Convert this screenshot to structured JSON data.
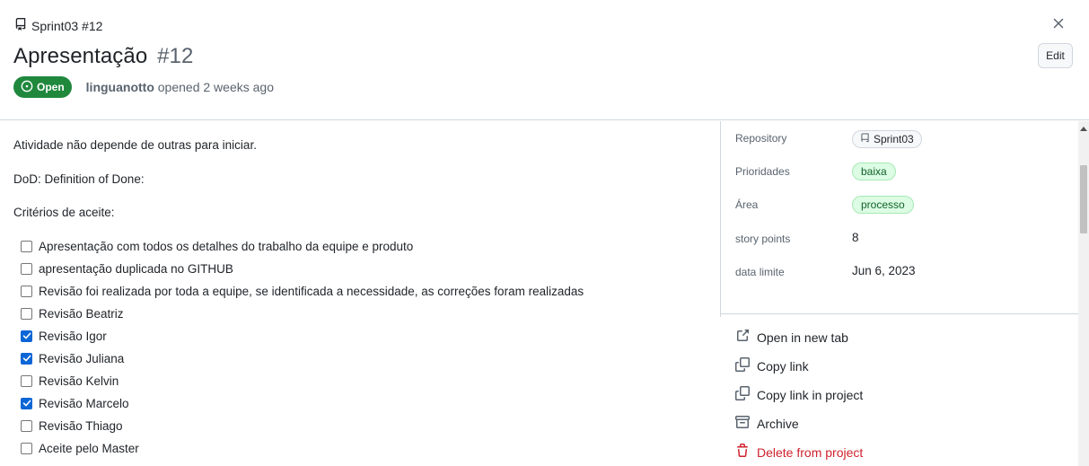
{
  "header": {
    "breadcrumb": "Sprint03 #12",
    "title": "Apresentação",
    "number": "#12",
    "state": "Open",
    "author": "linguanotto",
    "opened_text": "opened 2 weeks ago",
    "edit_label": "Edit",
    "close_icon": "close-icon"
  },
  "body": {
    "paragraphs": [
      "Atividade não depende de outras para iniciar.",
      "DoD: Definition of Done:",
      "Critérios de aceite:"
    ],
    "tasks": [
      {
        "label": "Apresentação com todos os detalhes do trabalho da equipe e produto",
        "checked": false
      },
      {
        "label": "apresentação duplicada no GITHUB",
        "checked": false
      },
      {
        "label": "Revisão foi realizada por toda a equipe, se identificada a necessidade, as correções foram realizadas",
        "checked": false
      },
      {
        "label": "Revisão Beatriz",
        "checked": false
      },
      {
        "label": "Revisão Igor",
        "checked": true
      },
      {
        "label": "Revisão Juliana",
        "checked": true
      },
      {
        "label": "Revisão Kelvin",
        "checked": false
      },
      {
        "label": "Revisão Marcelo",
        "checked": true
      },
      {
        "label": "Revisão Thiago",
        "checked": false
      },
      {
        "label": "Aceite pelo Master",
        "checked": false
      }
    ]
  },
  "fields": {
    "repository_label": "Repository",
    "repository_value": "Sprint03",
    "prioridades_label": "Prioridades",
    "prioridades_value": "baixa",
    "area_label": "Área",
    "area_value": "processo",
    "story_points_label": "story points",
    "story_points_value": "8",
    "data_limite_label": "data limite",
    "data_limite_value": "Jun 6, 2023"
  },
  "actions": {
    "open_new_tab": "Open in new tab",
    "copy_link": "Copy link",
    "copy_link_project": "Copy link in project",
    "archive": "Archive",
    "delete": "Delete from project"
  },
  "colors": {
    "open_green": "#1f883d",
    "label_bg": "#dcfce4",
    "label_text": "#116329",
    "danger": "#cf222e",
    "checkbox_checked": "#0b66d6"
  }
}
